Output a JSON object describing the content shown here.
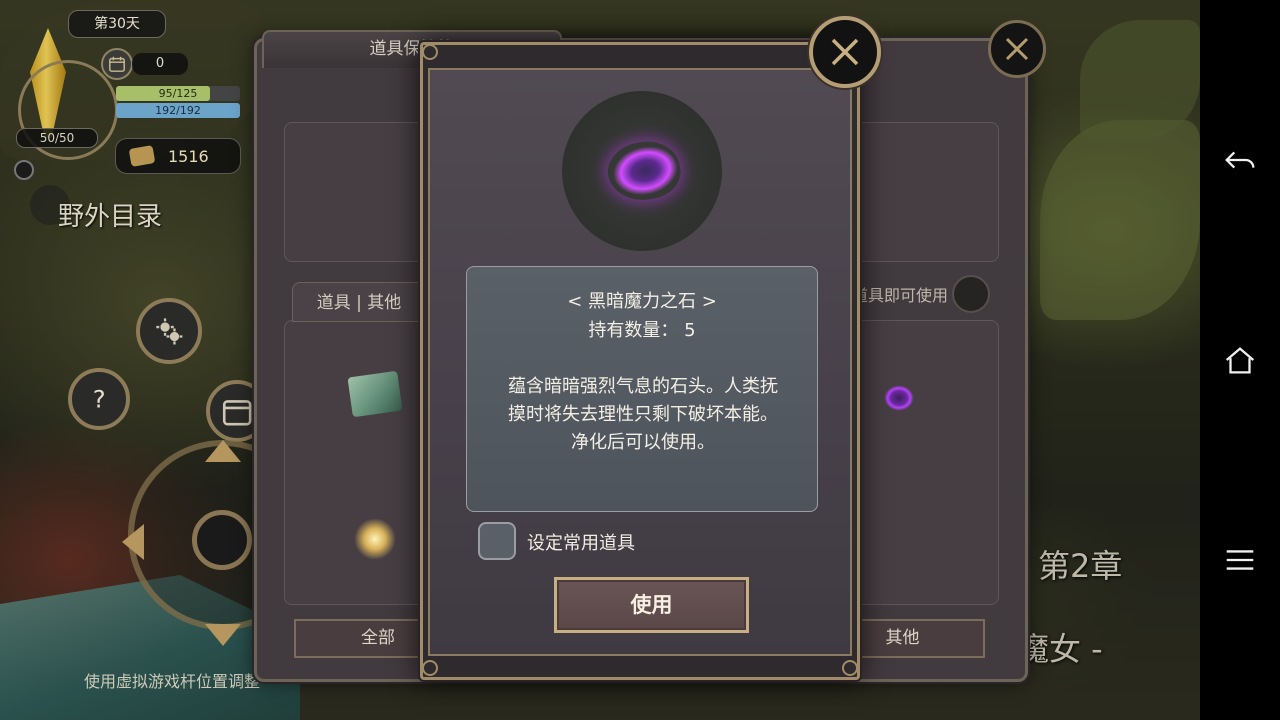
{
  "hud": {
    "day_label": "第30天",
    "counter_value": "0",
    "hp_text": "95/125",
    "hp_fraction": 0.76,
    "mp_text": "192/192",
    "crystal_text": "50/50",
    "gold_value": "1516",
    "field_directory_label": "野外目录",
    "joystick_hint": "使用虚拟游戏杆位置调整"
  },
  "chapter": {
    "title": "第2章",
    "subtitle": "的魔女 -"
  },
  "inventory": {
    "title": "道具保管箱",
    "tab_label": "道具 | 其他",
    "use_hint": "道具即可使用",
    "bottom_tabs": [
      "全部",
      "其他"
    ]
  },
  "dialog": {
    "item_name": "< 黑暗魔力之石 >",
    "count_label": "持有数量：",
    "count_value": "5",
    "description_lines": [
      "蕴含暗暗强烈气息的石头。人类抚",
      "摸时将失去理性只剩下破坏本能。",
      "净化后可以使用。"
    ],
    "favorite_label": "设定常用道具",
    "use_button": "使用"
  },
  "icons": {
    "close": "close-x-icon",
    "calendar": "calendar-icon",
    "settings": "gear-icon",
    "help": "question-icon",
    "back": "back-arrow-icon",
    "home": "home-icon",
    "recents": "menu-lines-icon"
  },
  "colors": {
    "gold_border": "#b59e75",
    "panel_bg": "#47404a",
    "desc_bg": "#5a6068"
  }
}
